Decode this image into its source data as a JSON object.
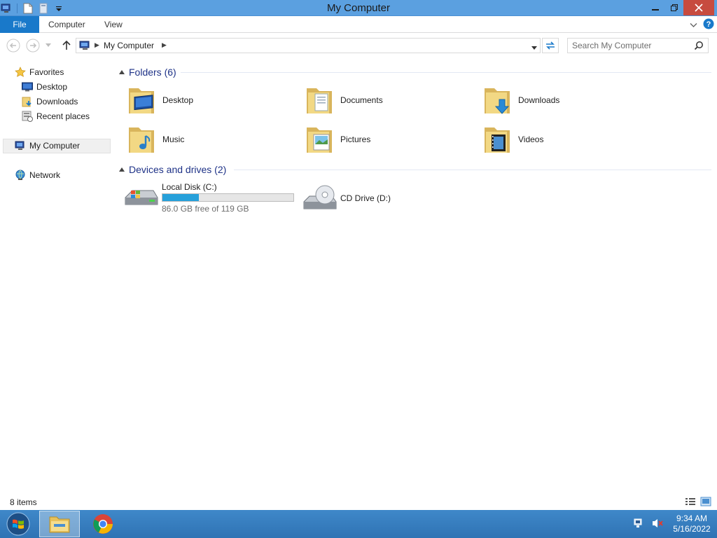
{
  "window": {
    "title": "My Computer"
  },
  "ribbon": {
    "file_label": "File",
    "tabs": [
      "Computer",
      "View"
    ]
  },
  "address": {
    "location": "My Computer"
  },
  "search": {
    "placeholder": "Search My Computer"
  },
  "nav": {
    "favorites_label": "Favorites",
    "favorites": [
      "Desktop",
      "Downloads",
      "Recent places"
    ],
    "this_pc": "My Computer",
    "network": "Network"
  },
  "folders_group": {
    "label": "Folders (6)"
  },
  "folders": [
    "Desktop",
    "Documents",
    "Downloads",
    "Music",
    "Pictures",
    "Videos"
  ],
  "devices_group": {
    "label": "Devices and drives (2)"
  },
  "drives": [
    {
      "name": "Local Disk (C:)",
      "free_text": "86.0 GB free of 119 GB",
      "used_fraction": 0.277
    },
    {
      "name": "CD Drive (D:)"
    }
  ],
  "status": {
    "item_count": "8 items"
  },
  "taskbar": {
    "time": "9:34 AM",
    "date": "5/16/2022"
  },
  "colors": {
    "titlebar": "#5ba0e0",
    "file_tab": "#1979ca",
    "group_header": "#1e3287",
    "capacity_fill": "#26a0da",
    "taskbar": "#3f88c9"
  }
}
